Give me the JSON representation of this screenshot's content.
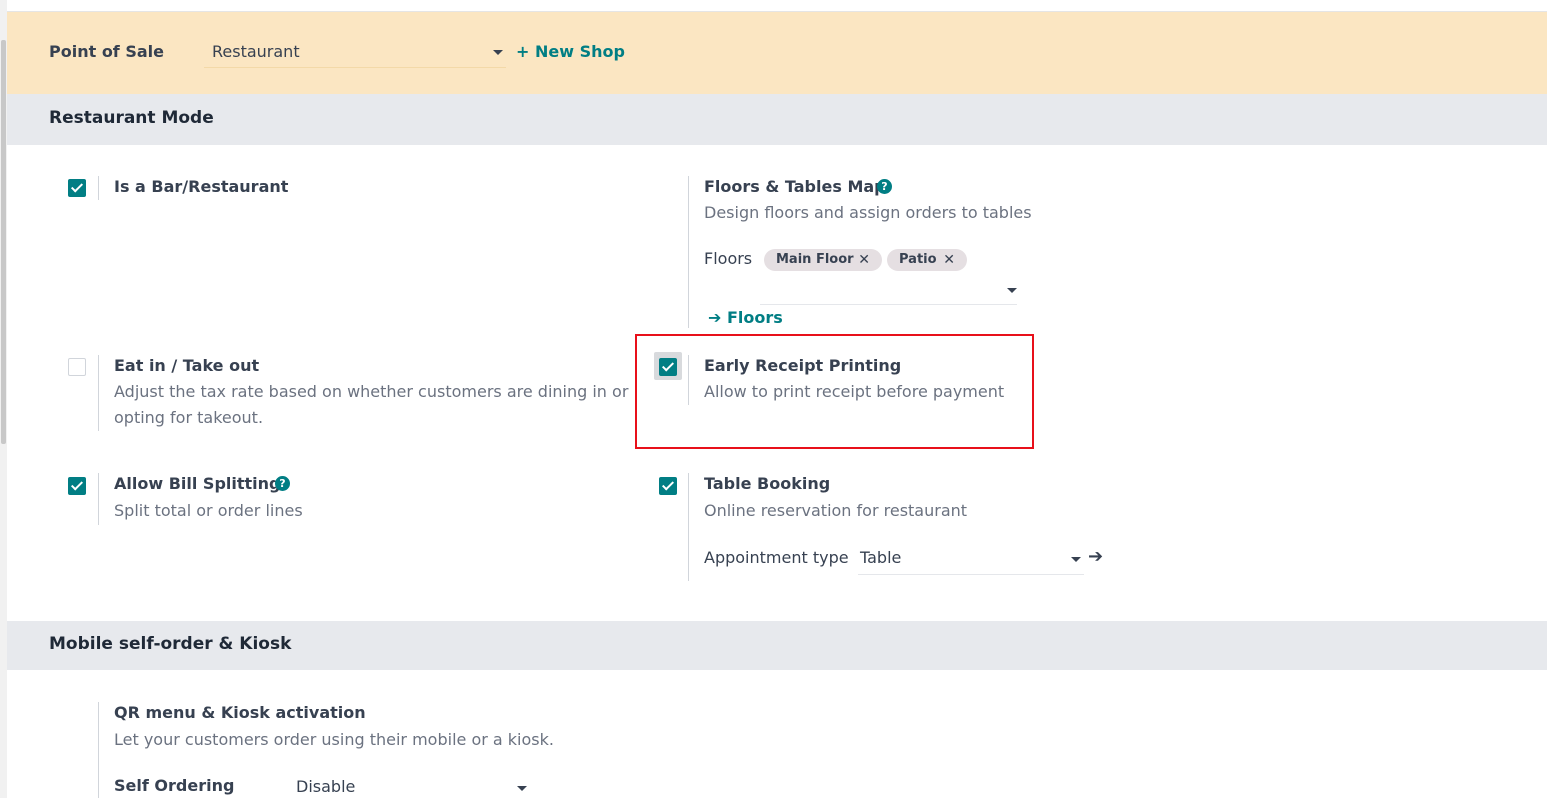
{
  "header": {
    "pos_label": "Point of Sale",
    "shop_value": "Restaurant",
    "new_shop": "+ New Shop"
  },
  "section_restaurant": {
    "title": "Restaurant Mode",
    "bar_restaurant": {
      "title": "Is a Bar/Restaurant",
      "checked": true
    },
    "floors_map": {
      "title": "Floors & Tables Map",
      "desc": "Design floors and assign orders to tables",
      "floors_label": "Floors",
      "tags": [
        "Main Floor",
        "Patio"
      ],
      "tag_remove": "✕",
      "link": "Floors",
      "link_arrow": "➔"
    },
    "eat_in": {
      "title": "Eat in / Take out",
      "desc": "Adjust the tax rate based on whether customers are dining in or opting for takeout.",
      "checked": false
    },
    "early_receipt": {
      "title": "Early Receipt Printing",
      "desc": "Allow to print receipt before payment",
      "checked": true
    },
    "bill_splitting": {
      "title": "Allow Bill Splitting",
      "desc": "Split total or order lines",
      "checked": true
    },
    "table_booking": {
      "title": "Table Booking",
      "desc": "Online reservation for restaurant",
      "checked": true,
      "appointment_label": "Appointment type",
      "appointment_value": "Table",
      "appointment_arrow": "➔"
    }
  },
  "section_mobile": {
    "title": "Mobile self-order & Kiosk",
    "qr": {
      "title": "QR menu & Kiosk activation",
      "desc": "Let your customers order using their mobile or a kiosk."
    },
    "self_ordering_label": "Self Ordering",
    "self_ordering_value": "Disable"
  },
  "icons": {
    "help": "?"
  },
  "colors": {
    "accent": "#017e84",
    "highlight": "#e8101a",
    "banner": "#fbe6c2",
    "section_bg": "#e7e9ed"
  }
}
